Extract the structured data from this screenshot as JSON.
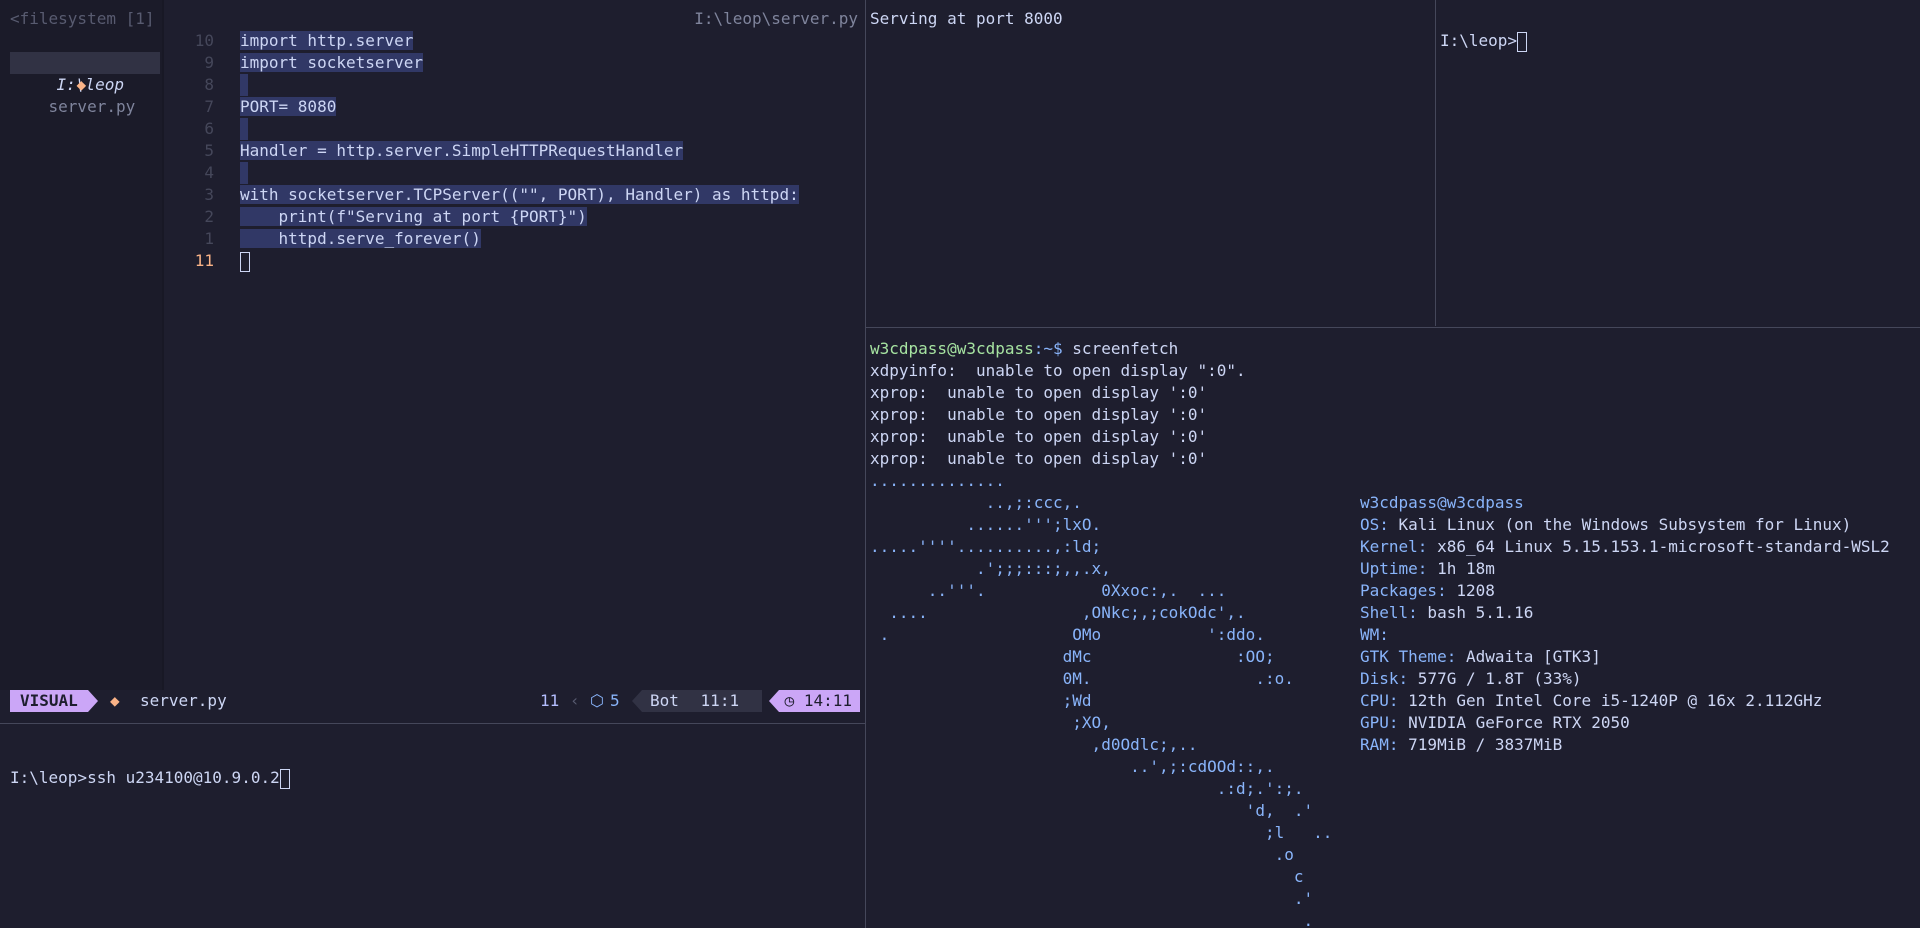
{
  "tree": {
    "header": "<filesystem [1]",
    "folder": "I:\\leop",
    "file": "server.py"
  },
  "editor": {
    "path": "I:\\leop\\server.py",
    "lines": [
      {
        "n": "10",
        "code": "import http.server"
      },
      {
        "n": "9",
        "code": "import socketserver"
      },
      {
        "n": "8",
        "code": ""
      },
      {
        "n": "7",
        "code": "PORT= 8080"
      },
      {
        "n": "6",
        "code": ""
      },
      {
        "n": "5",
        "code": "Handler = http.server.SimpleHTTPRequestHandler"
      },
      {
        "n": "4",
        "code": ""
      },
      {
        "n": "3",
        "code": "with socketserver.TCPServer((\"\", PORT), Handler) as httpd:"
      },
      {
        "n": "2",
        "code": "    print(f\"Serving at port {PORT}\")"
      },
      {
        "n": "1",
        "code": "    httpd.serve_forever()"
      },
      {
        "n": "11",
        "code": ""
      }
    ]
  },
  "statusline": {
    "mode": "VISUAL",
    "file": "server.py",
    "line": "11",
    "count": "5",
    "pos": "Bot",
    "cursor": "11:1",
    "time": "14:11"
  },
  "cmd_pane": {
    "prompt": "I:\\leop>ssh u234100@10.9.0.2"
  },
  "server_pane": {
    "text": "Serving at port 8000"
  },
  "right_top_pane": {
    "prompt": "I:\\leop>"
  },
  "screenfetch": {
    "user_host": "w3cdpass@w3cdpass",
    "prompt_suffix": ":~$ ",
    "command": "screenfetch",
    "errors": [
      "xdpyinfo:  unable to open display \":0\".",
      "xprop:  unable to open display ':0'",
      "xprop:  unable to open display ':0'",
      "xprop:  unable to open display ':0'",
      "xprop:  unable to open display ':0'"
    ],
    "art": [
      "..............",
      "            ..,;:ccc,.",
      "          ......''';lxO.",
      ".....''''..........,:ld;",
      "           .';;;:::;,,.x,",
      "      ..'''.            0Xxoc:,.  ...",
      "  ....                ,ONkc;,;cokOdc',.",
      " .                   OMo           ':ddo.",
      "                    dMc               :OO;",
      "                    0M.                 .:o.",
      "                    ;Wd",
      "                     ;XO,",
      "                       ,d0Odlc;,..",
      "                           ..',;:cdOOd::,.",
      "                                    .:d;.':;.",
      "                                       'd,  .'",
      "                                         ;l   ..",
      "                                          .o",
      "                                            c",
      "                                            .'",
      "                                             ."
    ],
    "info_title": "w3cdpass@w3cdpass",
    "info": [
      {
        "k": "OS:",
        "v": " Kali Linux (on the Windows Subsystem for Linux)"
      },
      {
        "k": "Kernel:",
        "v": " x86_64 Linux 5.15.153.1-microsoft-standard-WSL2"
      },
      {
        "k": "Uptime:",
        "v": " 1h 18m"
      },
      {
        "k": "Packages:",
        "v": " 1208"
      },
      {
        "k": "Shell:",
        "v": " bash 5.1.16"
      },
      {
        "k": "WM:",
        "v": ""
      },
      {
        "k": "GTK Theme:",
        "v": " Adwaita [GTK3]"
      },
      {
        "k": "Disk:",
        "v": " 577G / 1.8T (33%)"
      },
      {
        "k": "CPU:",
        "v": " 12th Gen Intel Core i5-1240P @ 16x 2.112GHz"
      },
      {
        "k": "GPU:",
        "v": " NVIDIA GeForce RTX 2050"
      },
      {
        "k": "RAM:",
        "v": " 719MiB / 3837MiB"
      }
    ]
  },
  "colors": {
    "bg": "#1e1e2e",
    "accent": "#cba6f7",
    "selection": "#313866",
    "green": "#a6e3a1",
    "blue": "#89b4fa"
  }
}
